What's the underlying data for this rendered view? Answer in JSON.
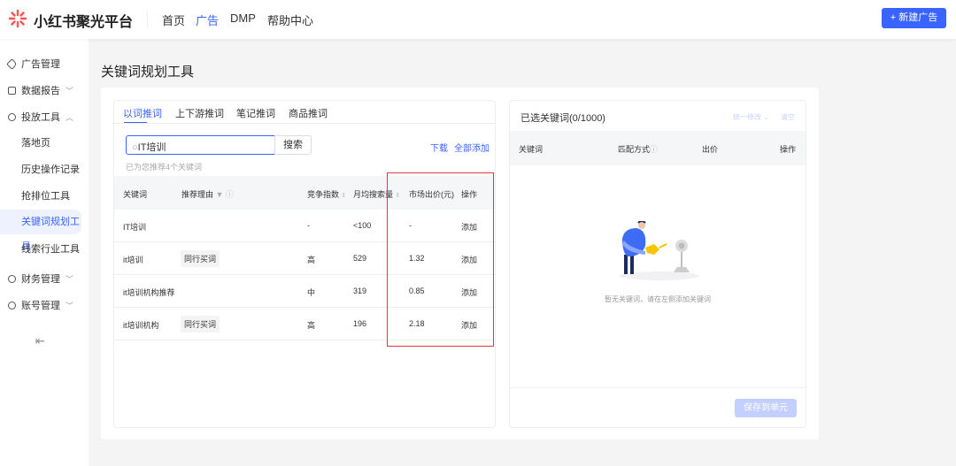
{
  "header": {
    "logo": "小红书聚光平台",
    "nav": [
      "首页",
      "广告",
      "DMP",
      "帮助中心"
    ],
    "active_nav": "广告",
    "new_button": "+ 新建广告"
  },
  "sidebar": {
    "groups": [
      {
        "label": "广告管理",
        "icon": "tag-icon"
      },
      {
        "label": "数据报告",
        "icon": "report-icon"
      },
      {
        "label": "投放工具",
        "icon": "tools-icon"
      },
      {
        "label": "财务管理",
        "icon": "finance-icon"
      },
      {
        "label": "账号管理",
        "icon": "account-icon"
      }
    ],
    "sub_items": [
      "落地页",
      "历史操作记录",
      "抢排位工具",
      "关键词规划工具",
      "线索行业工具"
    ],
    "active_sub": "关键词规划工具"
  },
  "page_title": "关键词规划工具",
  "left": {
    "tabs": [
      "以词推词",
      "上下游推词",
      "笔记推词",
      "商品推词"
    ],
    "active_tab": "以词推词",
    "search_value": "IT培训",
    "search_button": "搜索",
    "download": "下载",
    "add_all": "全部添加",
    "hint": "已为您推荐4个关键词",
    "columns": [
      "关键词",
      "推荐理由",
      "竞争指数",
      "月均搜索量",
      "市场出价(元)",
      "操作"
    ],
    "rows": [
      {
        "keyword": "IT培训",
        "reason": "",
        "competition": "-",
        "monthly": "<100",
        "price": "-",
        "action": "添加"
      },
      {
        "keyword": "it培训",
        "reason": "同行买词",
        "competition": "高",
        "monthly": "529",
        "price": "1.32",
        "action": "添加"
      },
      {
        "keyword": "it培训机构推荐",
        "reason": "",
        "competition": "中",
        "monthly": "319",
        "price": "0.85",
        "action": "添加"
      },
      {
        "keyword": "it培训机构",
        "reason": "同行买词",
        "competition": "高",
        "monthly": "196",
        "price": "2.18",
        "action": "添加"
      }
    ]
  },
  "right": {
    "title": "已选关键词(0/1000)",
    "bulk_edit": "统一修改",
    "clear": "清空",
    "columns": [
      "关键词",
      "匹配方式",
      "出价",
      "操作"
    ],
    "empty_text": "暂无关键词，请在左侧添加关键词",
    "save_button": "保存到单元"
  },
  "colors": {
    "accent": "#3a64ff",
    "highlight_box": "#e0383e"
  }
}
